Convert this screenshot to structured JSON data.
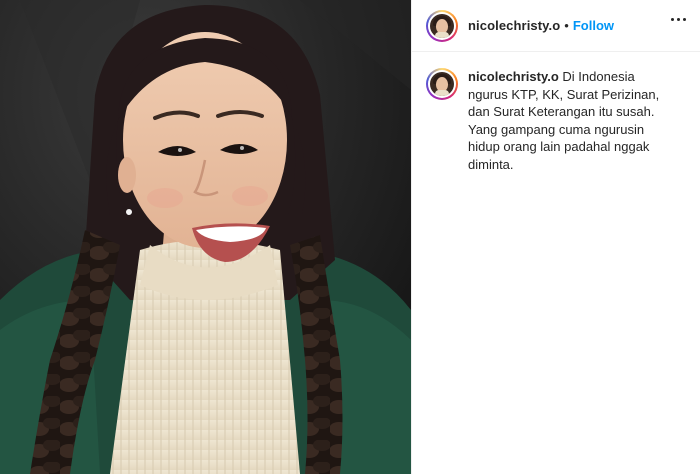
{
  "post": {
    "username": "nicolechristy.o",
    "separator": "•",
    "follow_label": "Follow",
    "more_icon": "more-options-icon",
    "caption": {
      "username": "nicolechristy.o",
      "text": "Di Indonesia ngurus KTP, KK, Surat Perizinan, dan Surat Keterangan itu susah. Yang gampang cuma ngurusin hidup orang lain padahal nggak diminta."
    }
  },
  "colors": {
    "follow": "#0095f6",
    "text": "#262626",
    "divider": "#efefef"
  }
}
